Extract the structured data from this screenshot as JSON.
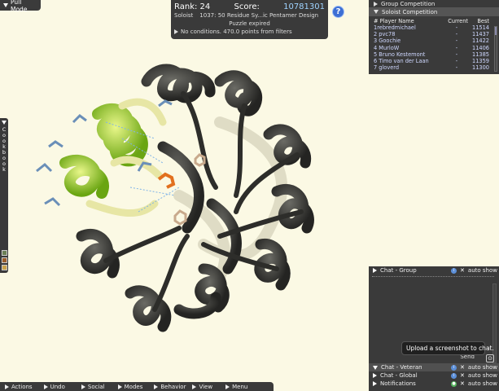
{
  "pull_mode": {
    "label": "Pull Mode"
  },
  "score_panel": {
    "rank_label": "Rank: 24",
    "score_label": "Score:",
    "score_value": "10781301",
    "mode": "Soloist",
    "puzzle_name": "1037: 50 Residue Sy...ic Pentamer Design",
    "status": "Puzzle expired",
    "conditions": "No conditions. 470.0 points from filters"
  },
  "help": {
    "label": "?"
  },
  "competition": {
    "group_tab": "Group Competition",
    "soloist_tab": "Soloist Competition",
    "columns": [
      "# Player Name",
      "Current",
      "Best"
    ],
    "rows": [
      {
        "name": "1rebredmichael",
        "current": "-",
        "best": "11514"
      },
      {
        "name": "2 pvc78",
        "current": "-",
        "best": "11437"
      },
      {
        "name": "3 Goochie",
        "current": "-",
        "best": "11422"
      },
      {
        "name": "4 MurloW",
        "current": "-",
        "best": "11406"
      },
      {
        "name": "5 Bruno Kestemont",
        "current": "-",
        "best": "11385"
      },
      {
        "name": "6 Timo van der Laan",
        "current": "-",
        "best": "11359"
      },
      {
        "name": "7 gloverd",
        "current": "-",
        "best": "11300"
      }
    ]
  },
  "cookbook": {
    "label": "Cookbook"
  },
  "chat": {
    "group": {
      "title": "Chat - Group",
      "auto": "auto show"
    },
    "veteran": {
      "title": "Chat - Veteran",
      "auto": "auto show"
    },
    "global": {
      "title": "Chat - Global",
      "auto": "auto show"
    },
    "notifications": {
      "title": "Notifications",
      "auto": "auto show"
    },
    "send": "Send",
    "tooltip": "Upload a screenshot to chat."
  },
  "bottom_bar": {
    "items": [
      "Actions",
      "Undo",
      "Social",
      "Modes",
      "Behavior",
      "View",
      "Menu"
    ]
  },
  "colors": {
    "panel": "#3a3a3a",
    "background": "#fbf9e4",
    "helix_green": "#9bd62a",
    "protein_dark": "#3b3b36",
    "accent_blue": "#3d6fd4"
  }
}
